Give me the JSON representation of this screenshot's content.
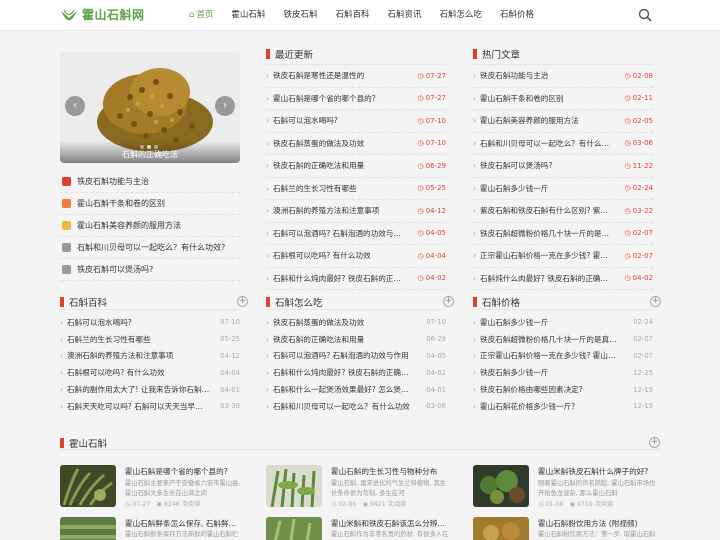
{
  "site": {
    "logo": "霍山石斛网",
    "brand_color": "#5aa245",
    "accent_color": "#e1402c"
  },
  "nav": [
    "首页",
    "霍山石斛",
    "铁皮石斛",
    "石斛百科",
    "石斛资讯",
    "石斛怎么吃",
    "石斛价格"
  ],
  "slider": {
    "caption": "石斛的正确吃法"
  },
  "sidebar_list": [
    {
      "title": "铁皮石斛功能与主治",
      "color": "#e1402c"
    },
    {
      "title": "霍山石斛干条和卷的区别",
      "color": "#f07e3e"
    },
    {
      "title": "霍山石斛美容养颜的服用方法",
      "color": "#f0b93e"
    },
    {
      "title": "石斛和川贝母可以一起吃么？有什么功效?",
      "color": "#9a9a9a"
    },
    {
      "title": "铁皮石斛可以煲汤吗?",
      "color": "#9a9a9a"
    }
  ],
  "latest": {
    "title": "最近更新",
    "items": [
      {
        "t": "铁皮石斛是寒性还是温性的",
        "d": "07-27"
      },
      {
        "t": "霍山石斛是哪个省的哪个县的?",
        "d": "07-27"
      },
      {
        "t": "石斛可以泡水喝吗?",
        "d": "07-10"
      },
      {
        "t": "铁皮石斛蒸蛋的做法及功效",
        "d": "07-10"
      },
      {
        "t": "铁皮石斛的正确吃法和用量",
        "d": "06-29"
      },
      {
        "t": "石斛兰的生长习性有哪些",
        "d": "05-25"
      },
      {
        "t": "澳洲石斛的养殖方法和注意事项",
        "d": "04-12"
      },
      {
        "t": "石斛可以泡酒吗? 石斛泡酒的功效与作用",
        "d": "04-05"
      },
      {
        "t": "石斛根可以吃吗? 有什么功效",
        "d": "04-04"
      },
      {
        "t": "石斛和什么炖肉最好? 铁皮石斛的正确吃法",
        "d": "04-02"
      }
    ]
  },
  "hot": {
    "title": "热门文章",
    "items": [
      {
        "t": "铁皮石斛功能与主治",
        "d": "02-08"
      },
      {
        "t": "霍山石斛干条和卷的区别",
        "d": "02-11"
      },
      {
        "t": "霍山石斛美容养颜的服用方法",
        "d": "02-05"
      },
      {
        "t": "石斛和川贝母可以一起吃么？有什么功效?",
        "d": "03-06"
      },
      {
        "t": "铁皮石斛可以煲汤吗?",
        "d": "11-22"
      },
      {
        "t": "霍山石斛多少钱一斤",
        "d": "02-24"
      },
      {
        "t": "紫皮石斛和铁皮石斛有什么区别? 紫皮石斛的功效",
        "d": "03-22"
      },
      {
        "t": "铁皮石斛超微粉价格几十块一斤的是真的吗",
        "d": "02-07"
      },
      {
        "t": "正宗霍山石斛价格一克在多少钱? 霍山石斛多少钱一克",
        "d": "02-07"
      },
      {
        "t": "石斛炖什么肉最好? 铁皮石斛的正确吃法",
        "d": "04-02"
      }
    ]
  },
  "sections": [
    {
      "title": "石斛百科",
      "items": [
        {
          "t": "石斛可以泡水喝吗?",
          "d": "07-10"
        },
        {
          "t": "石斛兰的生长习性有哪些",
          "d": "05-25"
        },
        {
          "t": "澳洲石斛的养殖方法和注意事项",
          "d": "04-12"
        },
        {
          "t": "石斛根可以吃吗? 有什么功效",
          "d": "04-04"
        },
        {
          "t": "石斛的副作用太大了! 让我来告诉你石斛有什么副作用",
          "d": "04-01"
        },
        {
          "t": "石斛天天吃可以吗? 石斛可以天天当早餐吃吗",
          "d": "03-30"
        }
      ]
    },
    {
      "title": "石斛怎么吃",
      "items": [
        {
          "t": "铁皮石斛蒸蛋的做法及功效",
          "d": "07-10"
        },
        {
          "t": "铁皮石斛的正确吃法和用量",
          "d": "06-29"
        },
        {
          "t": "石斛可以泡酒吗? 石斛泡酒的功效与作用",
          "d": "04-05"
        },
        {
          "t": "石斛和什么炖肉最好? 铁皮石斛的正确吃法",
          "d": "04-02"
        },
        {
          "t": "石斛和什么一起煲汤效果最好? 怎么煲汤最好",
          "d": "04-01"
        },
        {
          "t": "石斛和川贝母可以一起吃么？有什么功效",
          "d": "03-06"
        }
      ]
    },
    {
      "title": "石斛价格",
      "items": [
        {
          "t": "霍山石斛多少钱一斤",
          "d": "02-24"
        },
        {
          "t": "铁皮石斛超微粉价格几十块一斤的是真的吗",
          "d": "02-07"
        },
        {
          "t": "正宗霍山石斛价格一克在多少钱? 霍山石斛多少钱一克",
          "d": "02-07"
        },
        {
          "t": "铁皮石斛多少钱一斤",
          "d": "12-25"
        },
        {
          "t": "铁皮石斛价格由哪些因素决定?",
          "d": "12-19"
        },
        {
          "t": "霍山石斛花价格多少钱一斤?",
          "d": "12-19"
        }
      ]
    }
  ],
  "huoshan": {
    "title": "霍山石斛",
    "cards": [
      {
        "title": "霍山石斛是哪个省的哪个县的?",
        "desc": "霍山石斛主要来产于安徽省六安市霍山县,霍山石斛大多生长在山涧之间",
        "date": "07-27",
        "views": "8246 次阅读",
        "tone": "#6b7a3a"
      },
      {
        "title": "霍山石斛的生长习性与物种分布",
        "desc": "霍山石斛, 属末进化的气生兰科植物, 其生长条件很为苛刻, 多生在河",
        "date": "02-06",
        "views": "9421 次阅读",
        "tone": "#7da04a"
      },
      {
        "title": "霍山米斛铁皮石斛什么牌子的好?",
        "desc": "随着霍山石斛的声名鹊起, 霍山石斛市场也开始鱼龙混杂, 那么霍山石斛",
        "date": "01-08",
        "views": "9710 次阅读",
        "tone": "#4e6a3c"
      }
    ],
    "cards2": [
      {
        "title": "霍山石斛鲜条怎么保存, 石斛鲜品贮藏",
        "desc": "霍山石斛鲜条保存方法新鲜的霍山石斛贮藏",
        "tone": "#5f7a45"
      },
      {
        "title": "霍山米斛和铁皮石斛该怎么分辨真假?",
        "desc": "霍山石斛作为非常名贵的药材, 有很多人在购",
        "tone": "#6f8f4a"
      },
      {
        "title": "霍山石斛粉饮用方法 (附视频)",
        "desc": "霍山石斛粉饮用方法：第一步, 取霍山石斛",
        "tone": "#a07a2e"
      }
    ]
  }
}
